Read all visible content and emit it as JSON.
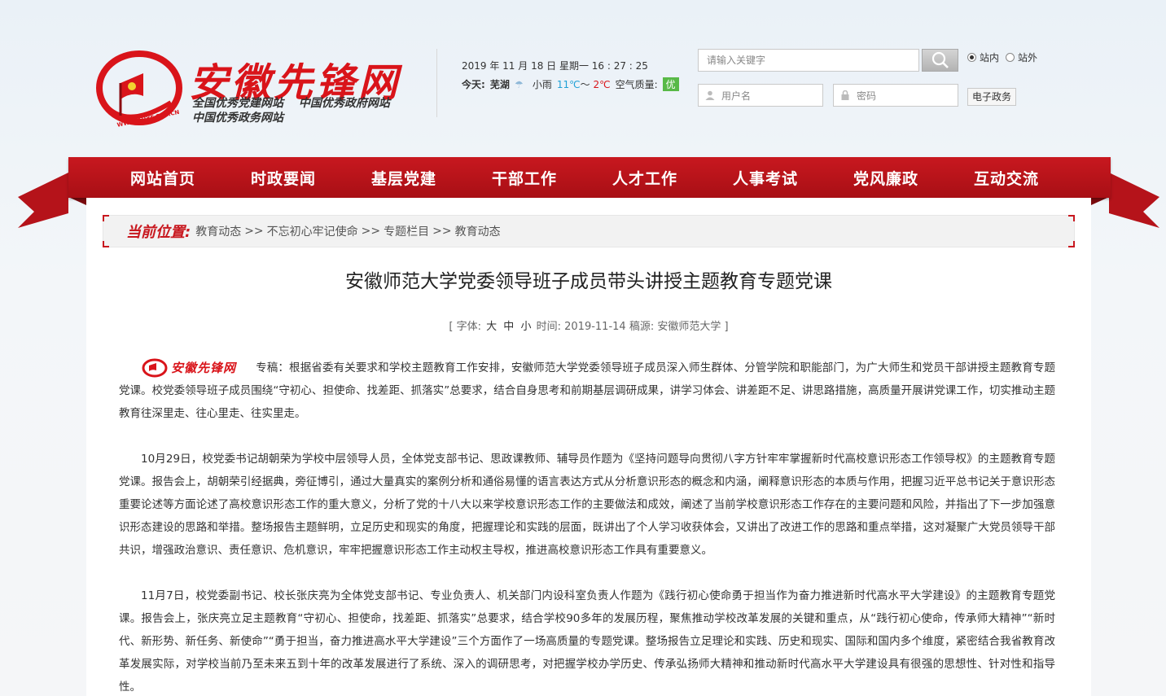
{
  "site": {
    "name": "安徽先锋网",
    "url_mark": "WWW.AHXF.GOV.CN",
    "subtitles": [
      "全国优秀党建网站",
      "中国优秀政府网站",
      "中国优秀政务网站"
    ]
  },
  "datetime": "2019 年 11 月 18 日 星期一 16 : 27 : 25",
  "weather": {
    "label": "今天:",
    "city": "芜湖",
    "condition": "小雨",
    "temp_low": "11℃",
    "separator": "～",
    "temp_high": "2℃",
    "aqi_label": "空气质量:",
    "aqi_value": "优"
  },
  "search": {
    "placeholder": "请输入关键字",
    "scope_options": [
      "站内",
      "站外"
    ],
    "scope_selected": "站内"
  },
  "login": {
    "username_placeholder": "用户名",
    "password_placeholder": "密码",
    "egov_label": "电子政务"
  },
  "nav": {
    "items": [
      "网站首页",
      "时政要闻",
      "基层党建",
      "干部工作",
      "人才工作",
      "人事考试",
      "党风廉政",
      "互动交流"
    ]
  },
  "breadcrumb": {
    "title": "当前位置:",
    "items": [
      "教育动态",
      "不忘初心牢记使命",
      "专题栏目",
      "教育动态"
    ],
    "separator": ">>"
  },
  "article": {
    "title": "安徽师范大学党委领导班子成员带头讲授主题教育专题党课",
    "meta": {
      "open": "[",
      "font_label": "字体:",
      "size_large": "大",
      "size_medium": "中",
      "size_small": "小",
      "time_label": "时间:",
      "time": "2019-11-14",
      "source_label": "稿源:",
      "source": "安徽师范大学",
      "close": "]"
    },
    "inline_logo_text": "安徽先锋网",
    "paragraphs": [
      "专稿：根据省委有关要求和学校主题教育工作安排，安徽师范大学党委领导班子成员深入师生群体、分管学院和职能部门，为广大师生和党员干部讲授主题教育专题党课。校党委领导班子成员围绕“守初心、担使命、找差距、抓落实”总要求，结合自身思考和前期基层调研成果，讲学习体会、讲差距不足、讲思路措施，高质量开展讲党课工作，切实推动主题教育往深里走、往心里走、往实里走。",
      "10月29日，校党委书记胡朝荣为学校中层领导人员，全体党支部书记、思政课教师、辅导员作题为《坚持问题导向贯彻八字方针牢牢掌握新时代高校意识形态工作领导权》的主题教育专题党课。报告会上，胡朝荣引经据典，旁征博引，通过大量真实的案例分析和通俗易懂的语言表达方式从分析意识形态的概念和内涵，阐释意识形态的本质与作用，把握习近平总书记关于意识形态重要论述等方面论述了高校意识形态工作的重大意义，分析了党的十八大以来学校意识形态工作的主要做法和成效，阐述了当前学校意识形态工作存在的主要问题和风险，并指出了下一步加强意识形态建设的思路和举措。整场报告主题鲜明，立足历史和现实的角度，把握理论和实践的层面，既讲出了个人学习收获体会，又讲出了改进工作的思路和重点举措，这对凝聚广大党员领导干部共识，增强政治意识、责任意识、危机意识，牢牢把握意识形态工作主动权主导权，推进高校意识形态工作具有重要意义。",
      "11月7日，校党委副书记、校长张庆亮为全体党支部书记、专业负责人、机关部门内设科室负责人作题为《践行初心使命勇于担当作为奋力推进新时代高水平大学建设》的主题教育专题党课。报告会上，张庆亮立足主题教育“守初心、担使命，找差距、抓落实”总要求，结合学校90多年的发展历程，聚焦推动学校改革发展的关键和重点，从“践行初心使命，传承师大精神”“新时代、新形势、新任务、新使命”“勇于担当，奋力推进高水平大学建设”三个方面作了一场高质量的专题党课。整场报告立足理论和实践、历史和现实、国际和国内多个维度，紧密结合我省教育改革发展实际，对学校当前乃至未来五到十年的改革发展进行了系统、深入的调研思考，对把握学校办学历史、传承弘扬师大精神和推动新时代高水平大学建设具有很强的思想性、针对性和指导性。"
    ]
  },
  "colors": {
    "brand_red": "#c8181f",
    "logo_red": "#d9141a",
    "aqi_green": "#58b947"
  }
}
